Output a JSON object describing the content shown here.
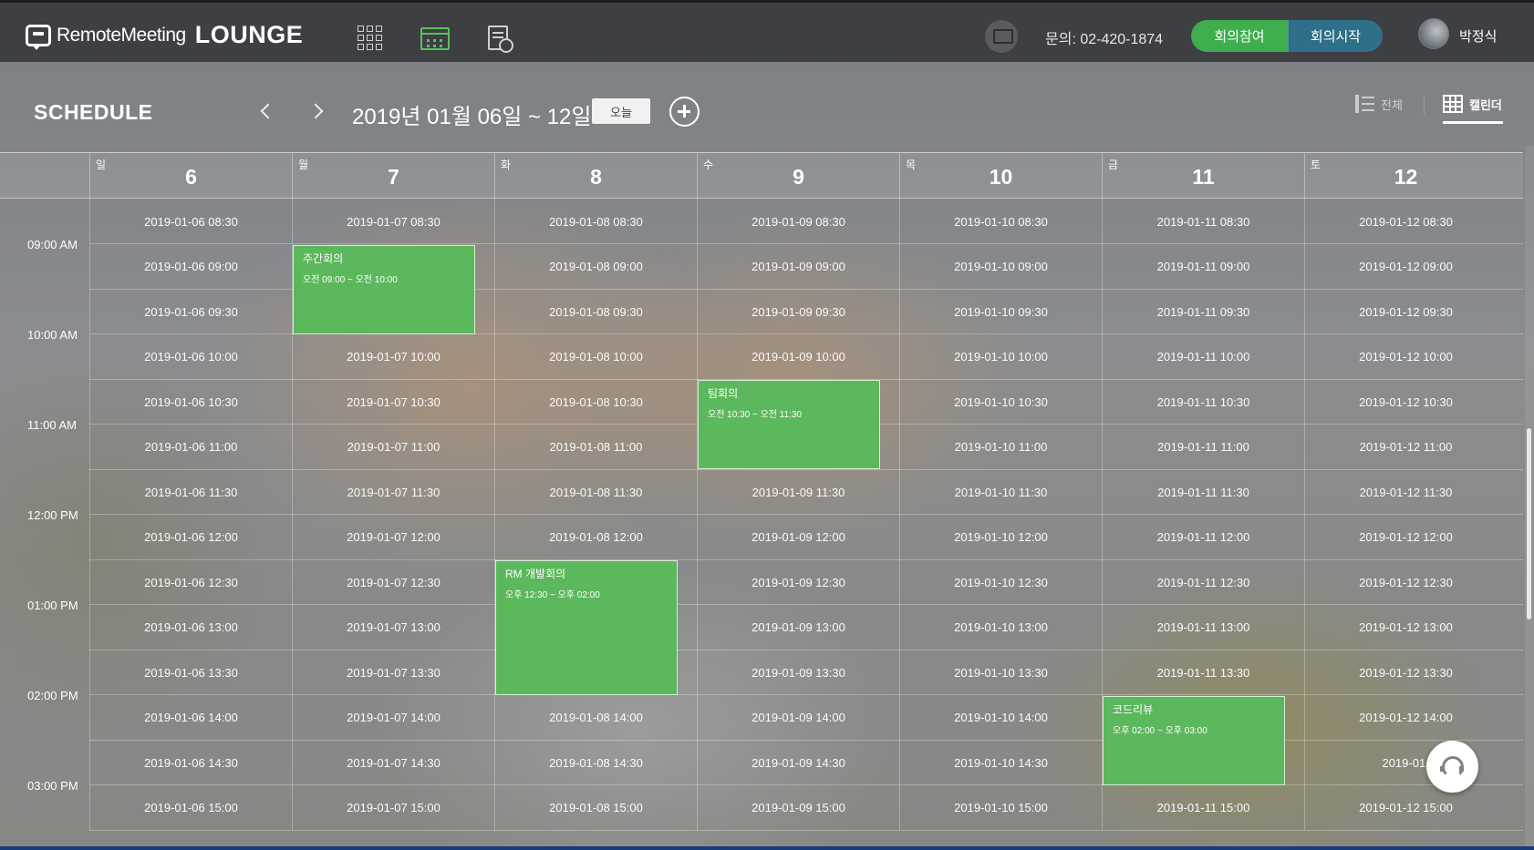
{
  "header": {
    "logo_text": "RemoteMeeting",
    "logo_lounge": "LOUNGE",
    "contact": "문의: 02-420-1874",
    "join_label": "회의참여",
    "start_label": "회의시작",
    "user_name": "박정식",
    "nav_icons": [
      "apps-grid-icon",
      "calendar-icon",
      "document-search-icon"
    ],
    "active_nav": "calendar-icon",
    "accent_green": "#3fae4f",
    "accent_blue": "#2e6f8a"
  },
  "schedule": {
    "title": "SCHEDULE",
    "date_range": "2019년 01월 06일 ~ 12일",
    "today_label": "오늘",
    "view_all_label": "전체",
    "view_calendar_label": "캘린더",
    "active_view": "캘린더"
  },
  "days": [
    {
      "dow": "일",
      "num": "6",
      "date": "2019-01-06"
    },
    {
      "dow": "월",
      "num": "7",
      "date": "2019-01-07"
    },
    {
      "dow": "화",
      "num": "8",
      "date": "2019-01-08"
    },
    {
      "dow": "수",
      "num": "9",
      "date": "2019-01-09"
    },
    {
      "dow": "목",
      "num": "10",
      "date": "2019-01-10"
    },
    {
      "dow": "금",
      "num": "11",
      "date": "2019-01-11"
    },
    {
      "dow": "토",
      "num": "12",
      "date": "2019-01-12"
    }
  ],
  "slots": [
    "08:30",
    "09:00",
    "09:30",
    "10:00",
    "10:30",
    "11:00",
    "11:30",
    "12:00",
    "12:30",
    "13:00",
    "13:30",
    "14:00",
    "14:30",
    "15:00"
  ],
  "time_labels": [
    {
      "slot": "09:00",
      "label": "09:00 AM"
    },
    {
      "slot": "10:00",
      "label": "10:00 AM"
    },
    {
      "slot": "11:00",
      "label": "11:00 AM"
    },
    {
      "slot": "12:00",
      "label": "12:00 PM"
    },
    {
      "slot": "13:00",
      "label": "01:00 PM"
    },
    {
      "slot": "14:00",
      "label": "02:00 PM"
    },
    {
      "slot": "15:00",
      "label": "03:00 PM"
    }
  ],
  "events": [
    {
      "day": "2019-01-07",
      "start": "09:00",
      "end": "10:00",
      "title": "주간회의",
      "time": "오전 09:00 ~ 오전 10:00",
      "color": "#5cb85c"
    },
    {
      "day": "2019-01-09",
      "start": "10:30",
      "end": "11:30",
      "title": "팀회의",
      "time": "오전 10:30 ~ 오전 11:30",
      "color": "#5cb85c"
    },
    {
      "day": "2019-01-08",
      "start": "12:30",
      "end": "14:00",
      "title": "RM 개발회의",
      "time": "오후 12:30 ~ 오후 02:00",
      "color": "#5cb85c"
    },
    {
      "day": "2019-01-11",
      "start": "14:00",
      "end": "15:00",
      "title": "코드리뷰",
      "time": "오후 02:00 ~ 오후 03:00",
      "color": "#5cb85c"
    }
  ],
  "partial_cell_text": "2019-01-",
  "partial_cell": {
    "day": "2019-01-12",
    "slot": "14:30"
  }
}
